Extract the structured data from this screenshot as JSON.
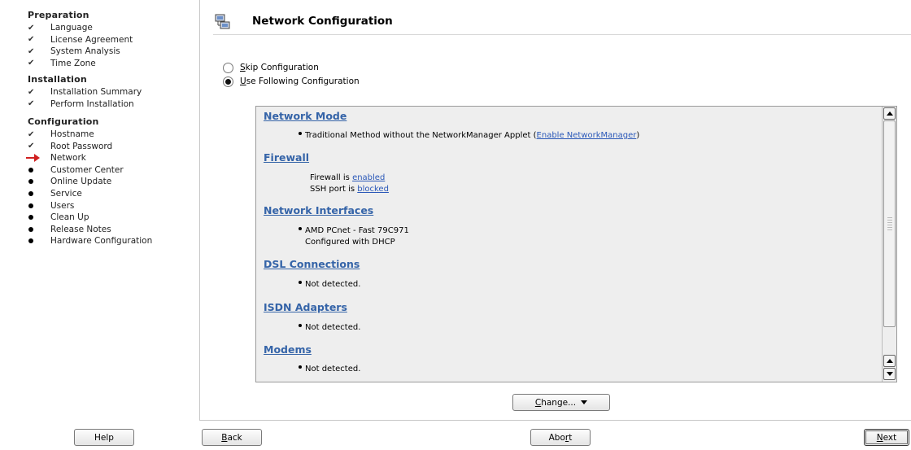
{
  "sidebar": {
    "sections": [
      {
        "title": "Preparation",
        "steps": [
          {
            "label": "Language",
            "state": "done"
          },
          {
            "label": "License Agreement",
            "state": "done"
          },
          {
            "label": "System Analysis",
            "state": "done"
          },
          {
            "label": "Time Zone",
            "state": "done"
          }
        ]
      },
      {
        "title": "Installation",
        "steps": [
          {
            "label": "Installation Summary",
            "state": "done"
          },
          {
            "label": "Perform Installation",
            "state": "done"
          }
        ]
      },
      {
        "title": "Configuration",
        "steps": [
          {
            "label": "Hostname",
            "state": "done"
          },
          {
            "label": "Root Password",
            "state": "done"
          },
          {
            "label": "Network",
            "state": "current"
          },
          {
            "label": "Customer Center",
            "state": "pending"
          },
          {
            "label": "Online Update",
            "state": "pending"
          },
          {
            "label": "Service",
            "state": "pending"
          },
          {
            "label": "Users",
            "state": "pending"
          },
          {
            "label": "Clean Up",
            "state": "pending"
          },
          {
            "label": "Release Notes",
            "state": "pending"
          },
          {
            "label": "Hardware Configuration",
            "state": "pending"
          }
        ]
      }
    ]
  },
  "main": {
    "title": "Network Configuration",
    "radios": {
      "skip": {
        "label_first": "S",
        "label_rest": "kip Configuration",
        "selected": false
      },
      "use": {
        "label_first": "U",
        "label_rest": "se Following Configuration",
        "selected": true
      }
    },
    "overview": {
      "network_mode": {
        "heading": "Network Mode",
        "item_text": "Traditional Method without the NetworkManager Applet (",
        "link": "Enable NetworkManager",
        "item_suffix": ")"
      },
      "firewall": {
        "heading": "Firewall",
        "line1_text": "Firewall is ",
        "line1_link": "enabled",
        "line2_text": "SSH port is ",
        "line2_link": "blocked"
      },
      "interfaces": {
        "heading": "Network Interfaces",
        "item": "AMD PCnet - Fast 79C971",
        "sub": "Configured with DHCP"
      },
      "dsl": {
        "heading": "DSL Connections",
        "item": "Not detected."
      },
      "isdn": {
        "heading": "ISDN Adapters",
        "item": "Not detected."
      },
      "modems": {
        "heading": "Modems",
        "item": "Not detected."
      }
    },
    "change_button": {
      "first": "C",
      "rest": "hange..."
    }
  },
  "buttons": {
    "help": "Help",
    "back_first": "B",
    "back_rest": "ack",
    "abort_pre": "Abo",
    "abort_u": "r",
    "abort_post": "t",
    "next_first": "N",
    "next_rest": "ext"
  },
  "colors": {
    "link": "#2a58b8",
    "heading": "#3564a8",
    "current_arrow": "#d02020",
    "panel_bg": "#eeeeee"
  }
}
